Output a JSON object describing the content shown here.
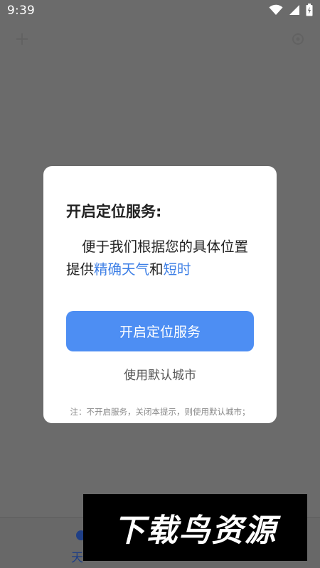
{
  "status_bar": {
    "time": "9:39",
    "icons": [
      "wifi-icon",
      "signal-icon",
      "battery-icon"
    ]
  },
  "background_app": {
    "bottom_nav_visible_label": "天"
  },
  "dialog": {
    "title": "开启定位服务:",
    "body": {
      "part1": "便于我们根据您的具体位置提供",
      "highlight1": "精确天气",
      "part2": "和",
      "highlight2": "短时"
    },
    "primary_button_label": "开启定位服务",
    "secondary_label": "使用默认城市",
    "note": "注：不开启服务，关闭本提示，则使用默认城市；"
  },
  "watermark": {
    "text": "下载鸟资源"
  },
  "colors": {
    "overlay": "#6b6b6b",
    "accent": "#4d8ef3",
    "highlight_text": "#3d7fe6"
  }
}
